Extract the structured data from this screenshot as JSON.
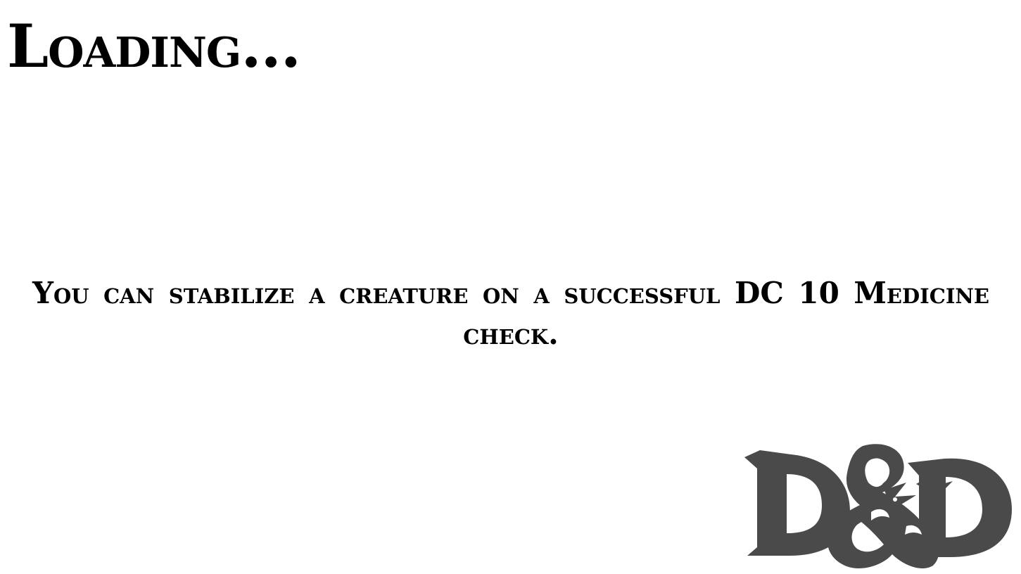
{
  "loading_screen": {
    "title": "Loading...",
    "tip": "You can stabilize a creature on a successful DC 10 Medicine check."
  },
  "logo": {
    "icon": "dnd-ampersand-dragon-logo",
    "color": "#4a4a4a",
    "letters": "D&D"
  },
  "colors": {
    "background": "#ffffff",
    "text": "#000000"
  }
}
